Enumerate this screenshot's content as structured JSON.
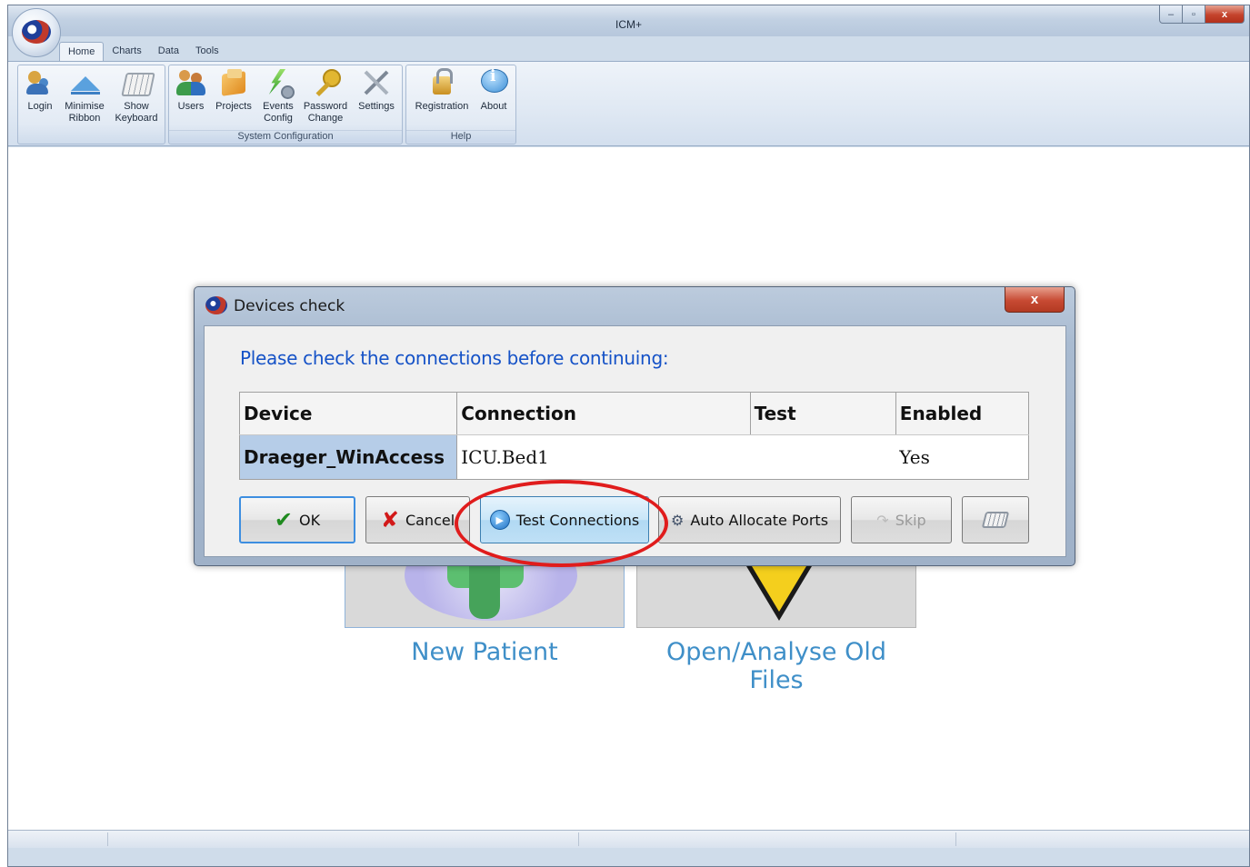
{
  "window": {
    "title": "ICM+",
    "minimize_glyph": "–",
    "maximize_glyph": "▫",
    "close_glyph": "x"
  },
  "ribbon": {
    "tabs": [
      "Home",
      "Charts",
      "Data",
      "Tools"
    ],
    "buttons": [
      {
        "line1": "Login",
        "line2": ""
      },
      {
        "line1": "Minimise",
        "line2": "Ribbon"
      },
      {
        "line1": "Show",
        "line2": "Keyboard"
      },
      {
        "line1": "Users",
        "line2": ""
      },
      {
        "line1": "Projects",
        "line2": ""
      },
      {
        "line1": "Events",
        "line2": "Config"
      },
      {
        "line1": "Password",
        "line2": "Change"
      },
      {
        "line1": "Settings",
        "line2": ""
      },
      {
        "line1": "Registration",
        "line2": ""
      },
      {
        "line1": "About",
        "line2": ""
      }
    ],
    "groups": {
      "system_configuration": "System Configuration",
      "help": "Help"
    }
  },
  "main": {
    "tiles": {
      "new_patient": "New Patient",
      "open_files": "Open/Analyse Old Files"
    }
  },
  "dialog": {
    "title": "Devices check",
    "close_glyph": "x",
    "message": "Please check the connections before continuing:",
    "table": {
      "headers": [
        "Device",
        "Connection",
        "Test",
        "Enabled"
      ],
      "rows": [
        {
          "device": "Draeger_WinAccess",
          "connection": "ICU.Bed1",
          "test": "",
          "enabled": "Yes"
        }
      ]
    },
    "buttons": {
      "ok": "OK",
      "cancel": "Cancel",
      "test_connections": "Test Connections",
      "auto_allocate": "Auto Allocate Ports",
      "skip": "Skip"
    },
    "icons": {
      "ok": "✔",
      "cancel": "✘",
      "test_connections": "▶",
      "auto_allocate": "⚙",
      "skip": "↷"
    }
  },
  "colors": {
    "accent_message": "#1552c7",
    "tile_label": "#3f8fc8",
    "highlight": "#e01c1c",
    "selected_cell": "#b6cde8"
  }
}
